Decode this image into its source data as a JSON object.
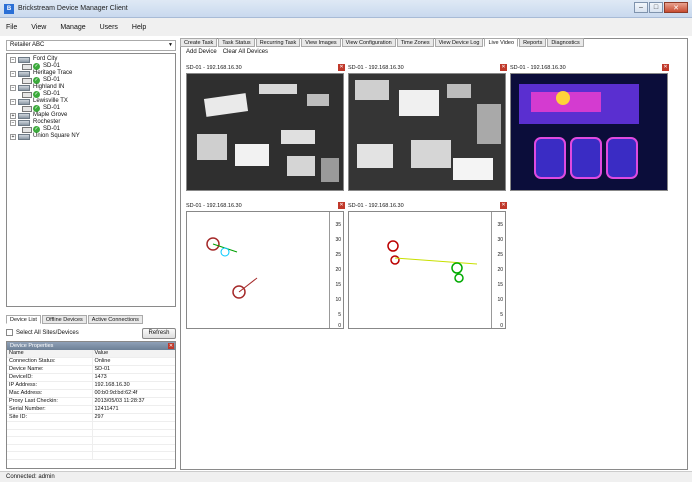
{
  "window": {
    "title": "Brickstream Device Manager Client",
    "buttons": [
      "–",
      "□",
      "✕"
    ]
  },
  "menu": [
    "File",
    "View",
    "Manage",
    "Users",
    "Help"
  ],
  "retailer": "Retailer ABC",
  "tree": [
    {
      "type": "site",
      "label": "Ford City",
      "expanded": true
    },
    {
      "type": "device",
      "label": "SD-01"
    },
    {
      "type": "site",
      "label": "Heritage Trace",
      "expanded": true
    },
    {
      "type": "device",
      "label": "SD-01"
    },
    {
      "type": "site",
      "label": "Highland IN",
      "expanded": true
    },
    {
      "type": "device",
      "label": "SD-01"
    },
    {
      "type": "site",
      "label": "Lewisville TX",
      "expanded": true
    },
    {
      "type": "device",
      "label": "SD-01"
    },
    {
      "type": "site",
      "label": "Maple Grove",
      "expanded": false
    },
    {
      "type": "site",
      "label": "Rochester",
      "expanded": true
    },
    {
      "type": "device",
      "label": "SD-01"
    },
    {
      "type": "site",
      "label": "Union Square NY",
      "expanded": false
    }
  ],
  "left_tabs": [
    "Device List",
    "Offline Devices",
    "Active Connections"
  ],
  "select_all_label": "Select All Sites/Devices",
  "refresh_label": "Refresh",
  "properties": {
    "title": "Device Properties",
    "header": [
      "Name",
      "Value"
    ],
    "rows": [
      [
        "Connection Status:",
        "Online"
      ],
      [
        "Device Name:",
        "SD-01"
      ],
      [
        "DeviceID:",
        "1473"
      ],
      [
        "IP Address:",
        "192.168.16.30"
      ],
      [
        "Mac Address:",
        "00:b0:9d:bd:62:4f"
      ],
      [
        "Proxy Last Checkin:",
        "2013/05/03 11:28:37"
      ],
      [
        "Serial Number:",
        "12411471"
      ],
      [
        "Site ID:",
        "297"
      ],
      [
        "",
        ""
      ],
      [
        "",
        ""
      ],
      [
        "",
        ""
      ],
      [
        "",
        ""
      ],
      [
        "",
        ""
      ]
    ]
  },
  "main_tabs": [
    "Create Task",
    "Task Status",
    "Recurring Task",
    "View Images",
    "View Configuration",
    "Time Zones",
    "View Device Log",
    "Live Video",
    "Reports",
    "Diagnostics"
  ],
  "active_tab": "Live Video",
  "sub_toolbar": [
    "Add Device",
    "Clear All Devices"
  ],
  "video_panels": [
    {
      "label": "SD-01 - 192.168.16.30",
      "feed": "grayscale"
    },
    {
      "label": "SD-01 - 192.168.16.30",
      "feed": "grayscale"
    },
    {
      "label": "SD-01 - 192.168.16.30",
      "feed": "heatmap"
    },
    {
      "label": "SD-01 - 192.168.16.30",
      "feed": "tracking"
    },
    {
      "label": "SD-01 - 192.168.16.30",
      "feed": "tracking"
    }
  ],
  "scale_ticks": [
    "35",
    "30",
    "25",
    "20",
    "15",
    "10",
    "5",
    "0"
  ],
  "status": "Connected: admin"
}
